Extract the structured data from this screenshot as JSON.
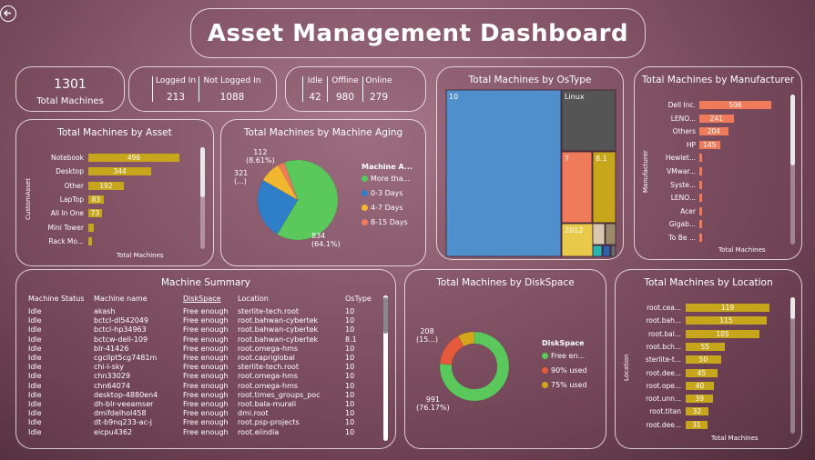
{
  "title": "Asset Management Dashboard",
  "back_icon": "back-arrow-icon",
  "kpi": {
    "total": {
      "value": "1301",
      "label": "Total Machines"
    },
    "logged": [
      {
        "label": "Logged In",
        "value": "213"
      },
      {
        "label": "Not Logged In",
        "value": "1088"
      }
    ],
    "status": [
      {
        "label": "Idle",
        "value": "42"
      },
      {
        "label": "Offline",
        "value": "980"
      },
      {
        "label": "Online",
        "value": "279"
      }
    ]
  },
  "asset": {
    "title": "Total Machines by Asset",
    "xlabel": "Total Machines",
    "ylabel": "CustomAsset"
  },
  "aging": {
    "title": "Total Machines by Machine Aging",
    "legend_title": "Machine A...",
    "labels": [
      {
        "v": "834",
        "p": "(64.1%)"
      },
      {
        "v": "321",
        "p": "(...)"
      },
      {
        "v": "112",
        "p": "(8.61%)"
      }
    ]
  },
  "ostype": {
    "title": "Total Machines by OsType"
  },
  "manufacturer": {
    "title": "Total Machines by Manufacturer",
    "xlabel": "Total Machines",
    "ylabel": "Manufacturer"
  },
  "summary": {
    "title": "Machine Summary",
    "columns": [
      "Machine Status",
      "Machine name",
      "DiskSpace",
      "Location",
      "OsType"
    ],
    "rows": [
      [
        "Idle",
        "akash",
        "Free enough",
        "sterlite-tech.root",
        "10"
      ],
      [
        "Idle",
        "bctcl-dl542049",
        "Free enough",
        "root.bahwan-cybertek",
        "10"
      ],
      [
        "Idle",
        "bctcl-hp34963",
        "Free enough",
        "root.bahwan-cybertek",
        "10"
      ],
      [
        "Idle",
        "bctcw-dell-109",
        "Free enough",
        "root.bahwan-cybertek",
        "8.1"
      ],
      [
        "Idle",
        "blr-41426",
        "Free enough",
        "root.omega-hms",
        "10"
      ],
      [
        "Idle",
        "cgcllpt5cg7481m",
        "Free enough",
        "root.capriglobal",
        "10"
      ],
      [
        "Idle",
        "chi-l-sky",
        "Free enough",
        "sterlite-tech.root",
        "10"
      ],
      [
        "Idle",
        "chn33029",
        "Free enough",
        "root.omega-hms",
        "10"
      ],
      [
        "Idle",
        "chn64074",
        "Free enough",
        "root.omega-hms",
        "10"
      ],
      [
        "Idle",
        "desktop-4880en4",
        "Free enough",
        "root.times_groups_poc",
        "10"
      ],
      [
        "Idle",
        "dh-blr-veeamser",
        "Free enough",
        "root.bala-murali",
        "10"
      ],
      [
        "Idle",
        "dmifdelhol458",
        "Free enough",
        "dmi.root",
        "10"
      ],
      [
        "Idle",
        "dt-b9nq233-ac-j",
        "Free enough",
        "root.psp-projects",
        "10"
      ],
      [
        "Idle",
        "eicpu4362",
        "Free enough",
        "root.eiindia",
        "10"
      ]
    ]
  },
  "disk": {
    "title": "Total Machines by DiskSpace",
    "legend_title": "DiskSpace",
    "labels": [
      {
        "v": "991",
        "p": "(76.17%)"
      },
      {
        "v": "208",
        "p": "(15...)"
      }
    ]
  },
  "location": {
    "title": "Total Machines by Location",
    "xlabel": "Total Machines",
    "ylabel": "Location"
  },
  "colors": {
    "gold": "#c7a61c",
    "salmon": "#f07b5a",
    "green": "#5ac85a",
    "blue": "#2f7ec9",
    "orange": "#f2b731",
    "red": "#e45a3a",
    "treeblue": "#4f8fcb",
    "treegray": "#555555"
  },
  "chart_data": [
    {
      "type": "bar",
      "name": "Total Machines by Asset",
      "categories": [
        "Notebook",
        "Desktop",
        "Other",
        "LapTop",
        "All In One",
        "Mini Tower",
        "Rack Mo..."
      ],
      "values": [
        496,
        344,
        192,
        83,
        73,
        30,
        20
      ],
      "xlabel": "Total Machines",
      "ylabel": "CustomAsset"
    },
    {
      "type": "pie",
      "name": "Total Machines by Machine Aging",
      "categories": [
        "More tha...",
        "0-3 Days",
        "4-7 Days",
        "8-15 Days"
      ],
      "values": [
        834,
        321,
        112,
        34
      ],
      "colors": [
        "#5ac85a",
        "#2f7ec9",
        "#f2b731",
        "#f07b5a"
      ]
    },
    {
      "type": "treemap",
      "name": "Total Machines by OsType",
      "categories": [
        "10",
        "Linux",
        "7",
        "8.1",
        "2012"
      ]
    },
    {
      "type": "bar",
      "name": "Total Machines by Manufacturer",
      "categories": [
        "Dell Inc.",
        "LENO...",
        "Others",
        "HP",
        "Hewlet...",
        "VMwar...",
        "Syste...",
        "LENO...",
        "Acer",
        "Gigab...",
        "To Be ..."
      ],
      "values": [
        506,
        241,
        204,
        145,
        20,
        15,
        10,
        8,
        6,
        5,
        4
      ],
      "xlabel": "Total Machines",
      "ylabel": "Manufacturer"
    },
    {
      "type": "pie",
      "name": "Total Machines by DiskSpace",
      "categories": [
        "Free en...",
        "90% used",
        "75% used"
      ],
      "values": [
        991,
        208,
        102
      ],
      "colors": [
        "#5ac85a",
        "#e45a3a",
        "#d4a61c"
      ]
    },
    {
      "type": "bar",
      "name": "Total Machines by Location",
      "categories": [
        "root.cea...",
        "root.bah...",
        "root.bal...",
        "root.bch...",
        "sterlite-t...",
        "root.dee...",
        "root.ope...",
        "root.unn...",
        "root.titan",
        "root.dee..."
      ],
      "values": [
        119,
        115,
        105,
        55,
        50,
        45,
        40,
        39,
        32,
        31
      ],
      "xlabel": "Total Machines",
      "ylabel": "Location"
    }
  ]
}
